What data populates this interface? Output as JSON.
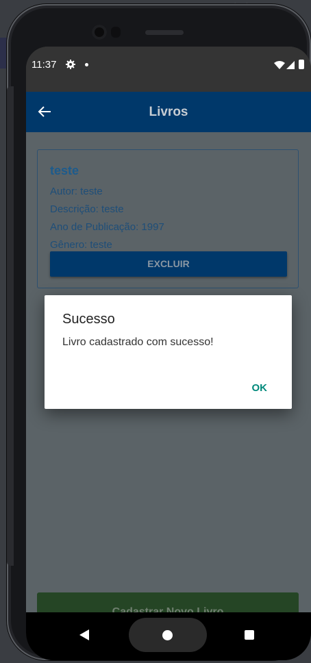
{
  "status_bar": {
    "time": "11:37",
    "icons": [
      "gear-icon",
      "dot-icon",
      "wifi-icon",
      "signal-icon",
      "battery-icon"
    ]
  },
  "appbar": {
    "title": "Livros",
    "back_icon": "back-arrow-icon"
  },
  "book_card": {
    "title": "teste",
    "author": "Autor: teste",
    "description": "Descrição: teste",
    "year": "Ano de Publicação: 1997",
    "genre": "Gênero: teste",
    "delete_label": "EXCLUIR"
  },
  "register_button_label": "Cadastrar Novo Livro",
  "dialog": {
    "title": "Sucesso",
    "message": "Livro cadastrado com sucesso!",
    "ok_label": "OK"
  },
  "nav_bar": {
    "icons": [
      "back-nav-icon",
      "home-nav-icon",
      "recents-nav-icon"
    ]
  },
  "colors": {
    "appbar": "#00386a",
    "register_button": "#254525",
    "dialog_accent": "#00897b",
    "card_text": "#1e4e79"
  }
}
